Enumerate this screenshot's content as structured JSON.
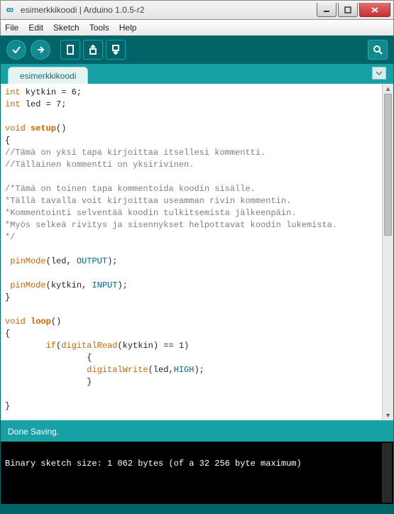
{
  "window": {
    "title": "esimerkkikoodi | Arduino 1.0.5-r2"
  },
  "menu": {
    "file": "File",
    "edit": "Edit",
    "sketch": "Sketch",
    "tools": "Tools",
    "help": "Help"
  },
  "tabs": {
    "active": "esimerkkikoodi"
  },
  "code": {
    "l1_a": "int",
    "l1_b": " kytkin = 6;",
    "l2_a": "int",
    "l2_b": " led = 7;",
    "l4_a": "void",
    "l4_b": " ",
    "l4_c": "setup",
    "l4_d": "()",
    "l5": "{",
    "l6": "//Tämä on yksi tapa kirjoittaa itsellesi kommentti.",
    "l7": "//Tällainen kommentti on yksirivinen.",
    "l9": "/*Tämä on toinen tapa kommentoida koodin sisälle.",
    "l10": "*Tällä tavalla voit kirjoittaa useamman rivin kommentin.",
    "l11": "*Kommentointi selventää koodin tulkitsemista jälkeenpäin.",
    "l12": "*Myös selkeä rivitys ja sisennykset helpottavat koodin lukemista.",
    "l13": "*/",
    "l15_a": " ",
    "l15_b": "pinMode",
    "l15_c": "(led, ",
    "l15_d": "OUTPUT",
    "l15_e": ");",
    "l17_a": " ",
    "l17_b": "pinMode",
    "l17_c": "(kytkin, ",
    "l17_d": "INPUT",
    "l17_e": ");",
    "l18": "}",
    "l20_a": "void",
    "l20_b": " ",
    "l20_c": "loop",
    "l20_d": "()",
    "l21": "{",
    "l22_a": "        ",
    "l22_b": "if",
    "l22_c": "(",
    "l22_d": "digitalRead",
    "l22_e": "(kytkin) == 1)",
    "l23": "                {",
    "l24_a": "                ",
    "l24_b": "digitalWrite",
    "l24_c": "(led,",
    "l24_d": "HIGH",
    "l24_e": ");",
    "l25": "                }",
    "l27": "}"
  },
  "status": {
    "text": "Done Saving."
  },
  "console": {
    "line": "Binary sketch size: 1 062 bytes (of a 32 256 byte maximum)"
  }
}
